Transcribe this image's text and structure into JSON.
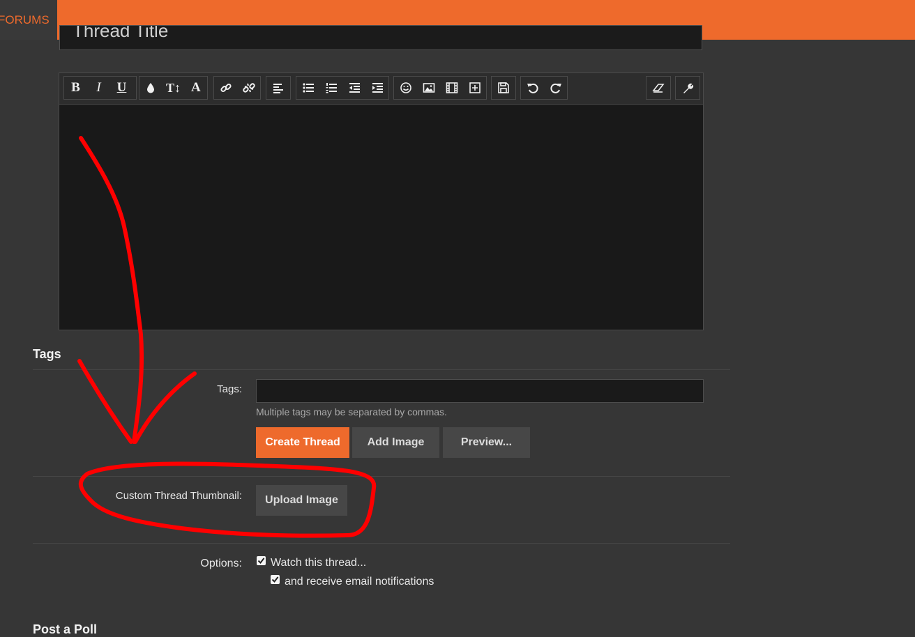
{
  "nav": {
    "forums_label": "FORUMS"
  },
  "title_field": {
    "value": "Thread Title"
  },
  "toolbar": {
    "bold": "B",
    "italic": "I",
    "underline": "U",
    "font_size": "T↕",
    "font_family": "A"
  },
  "tags_section": {
    "heading": "Tags",
    "tags_label": "Tags:",
    "tags_value": "",
    "hint": "Multiple tags may be separated by commas."
  },
  "buttons": {
    "create_thread": "Create Thread",
    "add_image": "Add Image",
    "preview": "Preview...",
    "upload_image": "Upload Image"
  },
  "thumbnail": {
    "label": "Custom Thread Thumbnail:"
  },
  "options": {
    "label": "Options:",
    "watch_thread": "Watch this thread...",
    "watch_checked": true,
    "email_notifications": "and receive email notifications",
    "email_checked": true
  },
  "poll": {
    "heading": "Post a Poll"
  },
  "colors": {
    "accent": "#ee6a2c",
    "background": "#363636",
    "annotation": "#ff0000"
  }
}
